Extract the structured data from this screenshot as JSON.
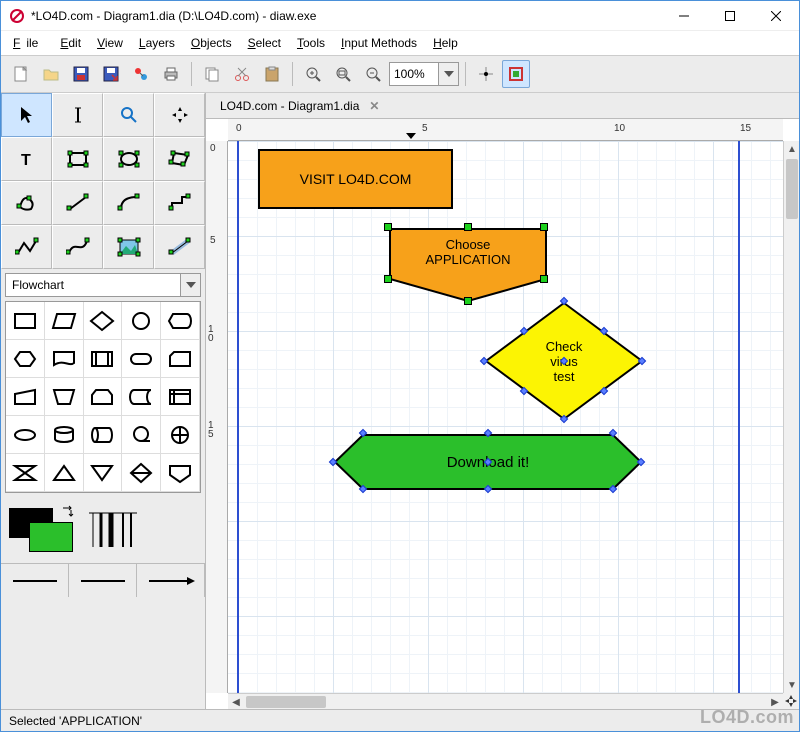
{
  "window": {
    "title": "*LO4D.com - Diagram1.dia (D:\\LO4D.com) - diaw.exe"
  },
  "menubar": {
    "file": "File",
    "edit": "Edit",
    "view": "View",
    "layers": "Layers",
    "objects": "Objects",
    "select": "Select",
    "tools": "Tools",
    "input_methods": "Input Methods",
    "help": "Help"
  },
  "toolbar": {
    "zoom_value": "100%"
  },
  "sidebar": {
    "shape_category": "Flowchart"
  },
  "tab": {
    "label": "LO4D.com - Diagram1.dia"
  },
  "ruler_h": {
    "t0": "0",
    "t5": "5",
    "t10": "10",
    "t15": "15"
  },
  "ruler_v": {
    "t0": "0",
    "t5": "5",
    "t10": "10",
    "t15": "15"
  },
  "shapes": {
    "box1": "VISIT LO4D.COM",
    "box2_line1": "Choose",
    "box2_line2": "APPLICATION",
    "diamond_line1": "Check",
    "diamond_line2": "virus",
    "diamond_line3": "test",
    "hex": "Download it!"
  },
  "statusbar": {
    "text": "Selected 'APPLICATION'"
  },
  "watermark": "LO4D.com"
}
